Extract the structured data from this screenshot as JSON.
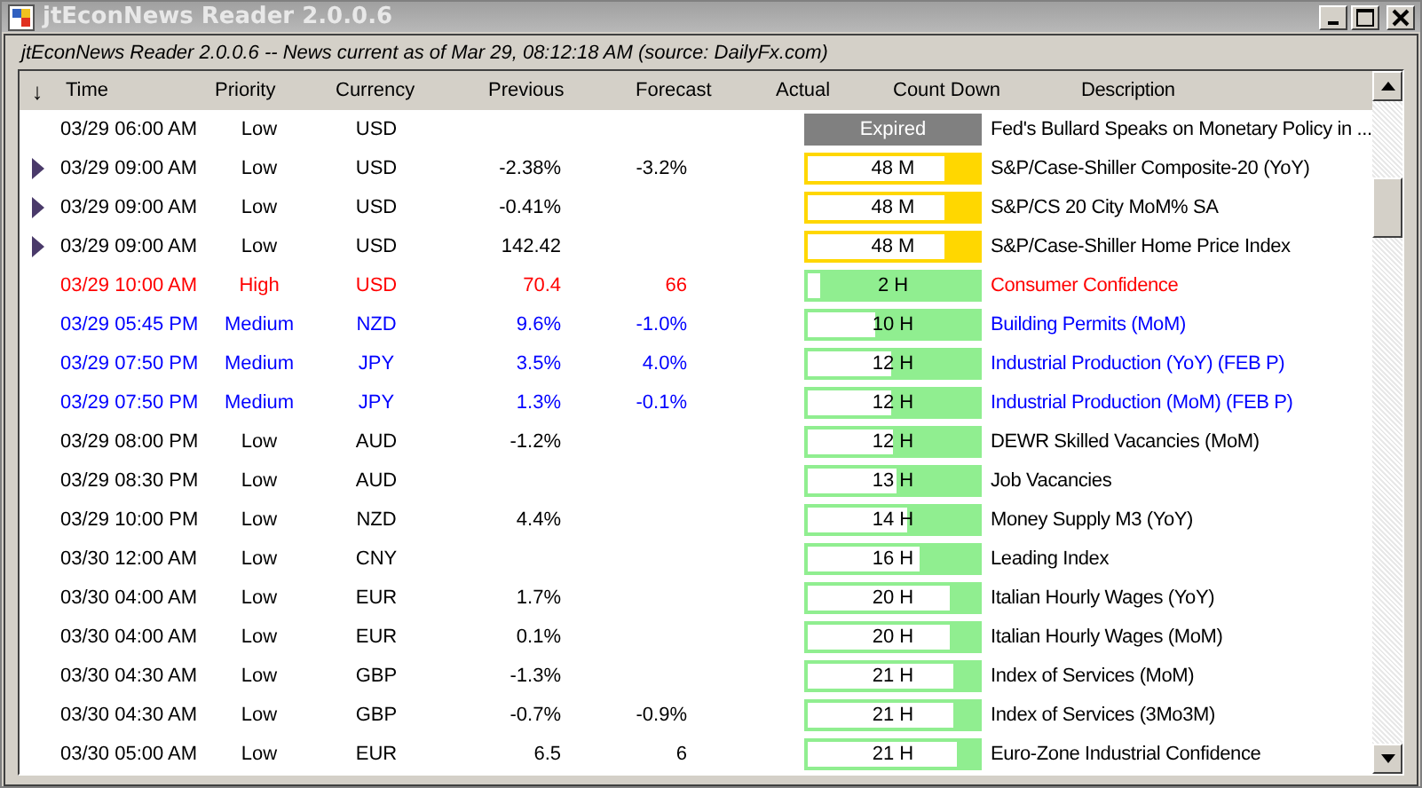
{
  "window": {
    "title": "jtEconNews Reader 2.0.0.6"
  },
  "status": "jtEconNews Reader 2.0.0.6  --  News current as of Mar 29, 08:12:18 AM  (source: DailyFx.com)",
  "table": {
    "sort_indicator": "↓",
    "columns": [
      "Time",
      "Priority",
      "Currency",
      "Previous",
      "Forecast",
      "Actual",
      "Count Down",
      "Description"
    ],
    "rows": [
      {
        "marked": false,
        "color": "#000000",
        "time": "03/29 06:00 AM",
        "priority": "Low",
        "currency": "USD",
        "previous": "",
        "forecast": "",
        "countdown": {
          "kind": "expired",
          "text": "Expired"
        },
        "description": "Fed's Bullard Speaks on Monetary Policy in ..."
      },
      {
        "marked": true,
        "color": "#000000",
        "time": "03/29 09:00 AM",
        "priority": "Low",
        "currency": "USD",
        "previous": "-2.38%",
        "forecast": "-3.2%",
        "countdown": {
          "kind": "minutes",
          "text": "48 M",
          "level": 0.2
        },
        "description": "S&P/Case-Shiller Composite-20 (YoY)"
      },
      {
        "marked": true,
        "color": "#000000",
        "time": "03/29 09:00 AM",
        "priority": "Low",
        "currency": "USD",
        "previous": "-0.41%",
        "forecast": "",
        "countdown": {
          "kind": "minutes",
          "text": "48 M",
          "level": 0.2
        },
        "description": "S&P/CS 20 City MoM% SA"
      },
      {
        "marked": true,
        "color": "#000000",
        "time": "03/29 09:00 AM",
        "priority": "Low",
        "currency": "USD",
        "previous": "142.42",
        "forecast": "",
        "countdown": {
          "kind": "minutes",
          "text": "48 M",
          "level": 0.2
        },
        "description": "S&P/Case-Shiller Home Price Index"
      },
      {
        "marked": false,
        "color": "#ff0000",
        "time": "03/29 10:00 AM",
        "priority": "High",
        "currency": "USD",
        "previous": "70.4",
        "forecast": "66",
        "countdown": {
          "kind": "hours",
          "text": "2 H",
          "level": 0.93
        },
        "description": "Consumer Confidence"
      },
      {
        "marked": false,
        "color": "#0000ff",
        "time": "03/29 05:45 PM",
        "priority": "Medium",
        "currency": "NZD",
        "previous": "9.6%",
        "forecast": "-1.0%",
        "countdown": {
          "kind": "hours",
          "text": "10 H",
          "level": 0.6
        },
        "description": "Building Permits (MoM)"
      },
      {
        "marked": false,
        "color": "#0000ff",
        "time": "03/29 07:50 PM",
        "priority": "Medium",
        "currency": "JPY",
        "previous": "3.5%",
        "forecast": "4.0%",
        "countdown": {
          "kind": "hours",
          "text": "12 H",
          "level": 0.51
        },
        "description": "Industrial Production (YoY) (FEB P)"
      },
      {
        "marked": false,
        "color": "#0000ff",
        "time": "03/29 07:50 PM",
        "priority": "Medium",
        "currency": "JPY",
        "previous": "1.3%",
        "forecast": "-0.1%",
        "countdown": {
          "kind": "hours",
          "text": "12 H",
          "level": 0.51
        },
        "description": "Industrial Production (MoM) (FEB P)"
      },
      {
        "marked": false,
        "color": "#000000",
        "time": "03/29 08:00 PM",
        "priority": "Low",
        "currency": "AUD",
        "previous": "-1.2%",
        "forecast": "",
        "countdown": {
          "kind": "hours",
          "text": "12 H",
          "level": 0.5
        },
        "description": "DEWR Skilled Vacancies (MoM)"
      },
      {
        "marked": false,
        "color": "#000000",
        "time": "03/29 08:30 PM",
        "priority": "Low",
        "currency": "AUD",
        "previous": "",
        "forecast": "",
        "countdown": {
          "kind": "hours",
          "text": "13 H",
          "level": 0.48
        },
        "description": "Job Vacancies"
      },
      {
        "marked": false,
        "color": "#000000",
        "time": "03/29 10:00 PM",
        "priority": "Low",
        "currency": "NZD",
        "previous": "4.4%",
        "forecast": "",
        "countdown": {
          "kind": "hours",
          "text": "14 H",
          "level": 0.42
        },
        "description": "Money Supply M3 (YoY)"
      },
      {
        "marked": false,
        "color": "#000000",
        "time": "03/30 12:00 AM",
        "priority": "Low",
        "currency": "CNY",
        "previous": "",
        "forecast": "",
        "countdown": {
          "kind": "hours",
          "text": "16 H",
          "level": 0.34
        },
        "description": "Leading Index"
      },
      {
        "marked": false,
        "color": "#000000",
        "time": "03/30 04:00 AM",
        "priority": "Low",
        "currency": "EUR",
        "previous": "1.7%",
        "forecast": "",
        "countdown": {
          "kind": "hours",
          "text": "20 H",
          "level": 0.17
        },
        "description": "Italian Hourly Wages (YoY)"
      },
      {
        "marked": false,
        "color": "#000000",
        "time": "03/30 04:00 AM",
        "priority": "Low",
        "currency": "EUR",
        "previous": "0.1%",
        "forecast": "",
        "countdown": {
          "kind": "hours",
          "text": "20 H",
          "level": 0.17
        },
        "description": "Italian Hourly Wages (MoM)"
      },
      {
        "marked": false,
        "color": "#000000",
        "time": "03/30 04:30 AM",
        "priority": "Low",
        "currency": "GBP",
        "previous": "-1.3%",
        "forecast": "",
        "countdown": {
          "kind": "hours",
          "text": "21 H",
          "level": 0.15
        },
        "description": "Index of Services (MoM)"
      },
      {
        "marked": false,
        "color": "#000000",
        "time": "03/30 04:30 AM",
        "priority": "Low",
        "currency": "GBP",
        "previous": "-0.7%",
        "forecast": "-0.9%",
        "countdown": {
          "kind": "hours",
          "text": "21 H",
          "level": 0.15
        },
        "description": "Index of Services (3Mo3M)"
      },
      {
        "marked": false,
        "color": "#000000",
        "time": "03/30 05:00 AM",
        "priority": "Low",
        "currency": "EUR",
        "previous": "6.5",
        "forecast": "6",
        "countdown": {
          "kind": "hours",
          "text": "21 H",
          "level": 0.13
        },
        "description": "Euro-Zone Industrial Confidence"
      }
    ]
  }
}
